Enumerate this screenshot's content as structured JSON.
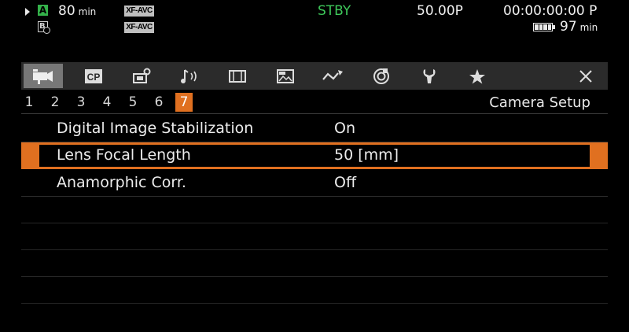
{
  "status": {
    "media_a_remaining": "80",
    "media_unit": "min",
    "slot_a": "A",
    "slot_b": "B",
    "format_1": "XF-AVC",
    "format_2": "XF-AVC",
    "mode": "STBY",
    "frame_rate": "50.00P",
    "timecode": "00:00:00:00 P",
    "battery_value": "97",
    "battery_unit": "min"
  },
  "menu": {
    "tabs": [
      {
        "icon": "camera-icon",
        "active": true
      },
      {
        "icon": "custom-picture-icon",
        "label": "CP"
      },
      {
        "icon": "recording-media-icon"
      },
      {
        "icon": "audio-icon"
      },
      {
        "icon": "monitoring-icon"
      },
      {
        "icon": "assignable-icon"
      },
      {
        "icon": "network-icon"
      },
      {
        "icon": "system-icon"
      },
      {
        "icon": "maintenance-icon"
      },
      {
        "icon": "my-menu-star-icon"
      }
    ],
    "close_icon": "close-icon",
    "pages": [
      "1",
      "2",
      "3",
      "4",
      "5",
      "6",
      "7"
    ],
    "active_page": "7",
    "section_title": "Camera Setup",
    "items": [
      {
        "label": "Digital Image Stabilization",
        "value": "On"
      },
      {
        "label": "Lens Focal Length",
        "value": "50 [mm]",
        "selected": true
      },
      {
        "label": "Anamorphic Corr.",
        "value": "Off"
      }
    ]
  },
  "colors": {
    "accent": "#e07020",
    "standby": "#3ec85a",
    "slot_a": "#34b24a",
    "tab_bar": "#2b2b2b"
  }
}
